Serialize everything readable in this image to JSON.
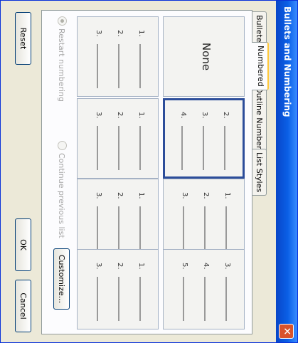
{
  "dialog": {
    "title": "Bullets and Numbering",
    "close_icon": "close-icon"
  },
  "tabs": [
    {
      "label": "Bulleted",
      "active": false
    },
    {
      "label": "Numbered",
      "active": true
    },
    {
      "label": "Outline Numbered",
      "active": false
    },
    {
      "label": "List Styles",
      "active": false
    }
  ],
  "gallery": {
    "none_label": "None",
    "cells": [
      {
        "numbers": [],
        "selected": false
      },
      {
        "numbers": [
          "2.",
          "3.",
          "4."
        ],
        "selected": true
      },
      {
        "numbers": [
          "1.",
          "2.",
          "3."
        ],
        "selected": false
      },
      {
        "numbers": [
          "3.",
          "4.",
          "5."
        ],
        "selected": false
      },
      {
        "numbers": [
          "1.",
          "2.",
          "3."
        ],
        "selected": false
      },
      {
        "numbers": [
          "1.",
          "2.",
          "3."
        ],
        "selected": false
      },
      {
        "numbers": [
          "1.",
          "2.",
          "3."
        ],
        "selected": false
      },
      {
        "numbers": [
          "1.",
          "2.",
          "3."
        ],
        "selected": false
      }
    ]
  },
  "options": {
    "restart_label": "Restart numbering",
    "continue_label": "Continue previous list",
    "selected": "restart"
  },
  "buttons": {
    "customize": "Customize...",
    "reset": "Reset",
    "ok": "OK",
    "cancel": "Cancel"
  },
  "colors": {
    "titlebar": "#0a5fe6",
    "selection": "#2c4d9a",
    "tab_highlight": "#ffc83c"
  }
}
